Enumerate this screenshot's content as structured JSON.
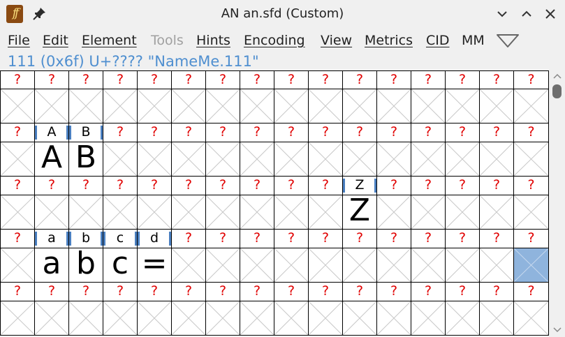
{
  "window": {
    "title": "AN an.sfd (Custom)",
    "logo_glyph": "ff",
    "icons": [
      "fontforge-logo-icon",
      "pin-icon",
      "minimize-icon",
      "maximize-icon",
      "close-icon"
    ]
  },
  "menubar": {
    "items": [
      {
        "label": "File",
        "disabled": false
      },
      {
        "label": "Edit",
        "disabled": false
      },
      {
        "label": "Element",
        "disabled": false
      },
      {
        "label": "Tools",
        "disabled": true
      },
      {
        "label": "Hints",
        "disabled": false
      },
      {
        "label": "Encoding",
        "disabled": false
      },
      {
        "label": "View",
        "disabled": false
      },
      {
        "label": "Metrics",
        "disabled": false
      },
      {
        "label": "CID",
        "disabled": false
      },
      {
        "label": "MM",
        "disabled": false
      }
    ],
    "overflow_icon": "triangle-down-icon"
  },
  "info": {
    "text": "111 (0x6f) U+???? \"NameMe.111\""
  },
  "colors": {
    "unknown_label": "#e00000",
    "known_marker": "#4a7fc0",
    "info_text": "#4f8fd0",
    "selection": "#8fb4dd"
  },
  "grid": {
    "columns": 16,
    "unknown_label": "?",
    "rows": [
      {
        "labels": [
          "?",
          "?",
          "?",
          "?",
          "?",
          "?",
          "?",
          "?",
          "?",
          "?",
          "?",
          "?",
          "?",
          "?",
          "?",
          "?"
        ],
        "glyphs": [
          "",
          "",
          "",
          "",
          "",
          "",
          "",
          "",
          "",
          "",
          "",
          "",
          "",
          "",
          "",
          ""
        ]
      },
      {
        "labels": [
          "?",
          "A",
          "B",
          "?",
          "?",
          "?",
          "?",
          "?",
          "?",
          "?",
          "?",
          "?",
          "?",
          "?",
          "?",
          "?"
        ],
        "glyphs": [
          "",
          "A",
          "B",
          "",
          "",
          "",
          "",
          "",
          "",
          "",
          "",
          "",
          "",
          "",
          "",
          ""
        ]
      },
      {
        "labels": [
          "?",
          "?",
          "?",
          "?",
          "?",
          "?",
          "?",
          "?",
          "?",
          "?",
          "Z",
          "?",
          "?",
          "?",
          "?",
          "?"
        ],
        "glyphs": [
          "",
          "",
          "",
          "",
          "",
          "",
          "",
          "",
          "",
          "",
          "Z",
          "",
          "",
          "",
          "",
          ""
        ]
      },
      {
        "labels": [
          "?",
          "a",
          "b",
          "c",
          "d",
          "?",
          "?",
          "?",
          "?",
          "?",
          "?",
          "?",
          "?",
          "?",
          "?",
          "?"
        ],
        "glyphs": [
          "",
          "a",
          "b",
          "c",
          "=",
          "",
          "",
          "",
          "",
          "",
          "",
          "",
          "",
          "",
          "",
          ""
        ]
      },
      {
        "labels": [
          "?",
          "?",
          "?",
          "?",
          "?",
          "?",
          "?",
          "?",
          "?",
          "?",
          "?",
          "?",
          "?",
          "?",
          "?",
          "?"
        ],
        "glyphs": [
          "",
          "",
          "",
          "",
          "",
          "",
          "",
          "",
          "",
          "",
          "",
          "",
          "",
          "",
          "",
          ""
        ]
      }
    ],
    "selected": {
      "row": 3,
      "col": 15
    }
  },
  "scrollbar": {
    "icons": [
      "scroll-up-arrow-icon",
      "scroll-down-arrow-icon"
    ]
  }
}
